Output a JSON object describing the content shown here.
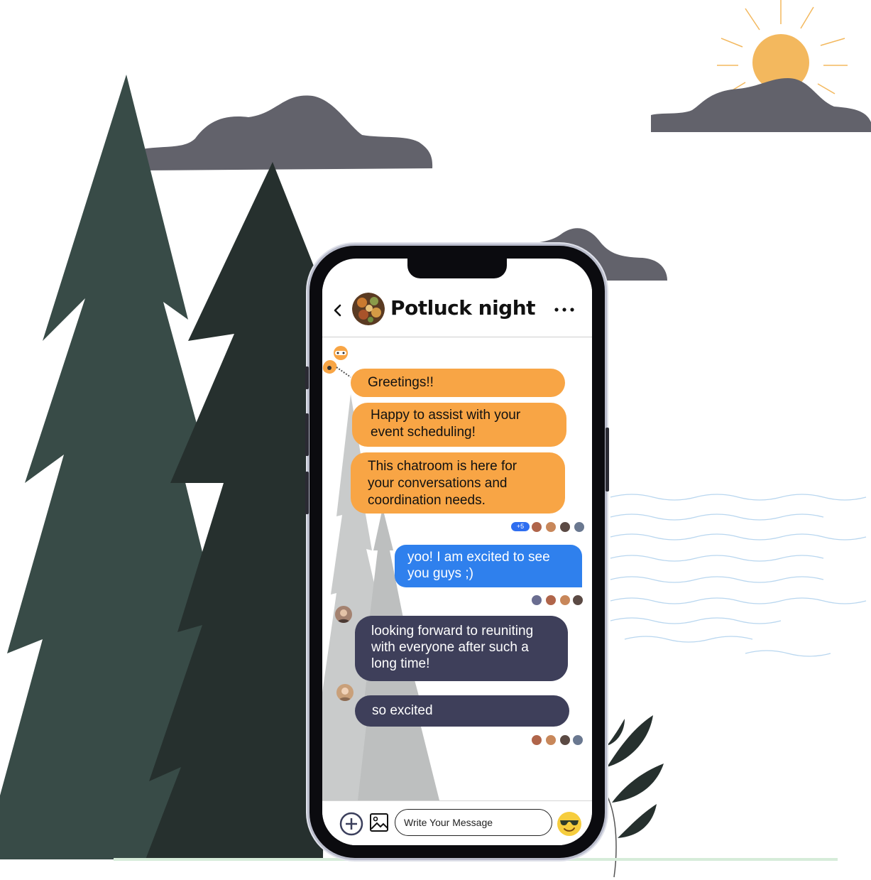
{
  "chat": {
    "title": "Potluck night",
    "back_icon": "chevron-left-icon",
    "more_icon": "more-horizontal-icon"
  },
  "messages": [
    {
      "sender": "bot",
      "text": "Greetings!!"
    },
    {
      "sender": "bot",
      "text": "Happy to assist with your event scheduling!"
    },
    {
      "sender": "bot",
      "text": "This chatroom is here for your conversations and coordination needs."
    },
    {
      "sender": "me",
      "text": "yoo! I am excited to see you guys ;)"
    },
    {
      "sender": "member",
      "text": "looking forward to reuniting with everyone after such a long time!"
    },
    {
      "sender": "member",
      "text": "so excited"
    }
  ],
  "read_receipts": {
    "extra_count": "+5"
  },
  "composer": {
    "placeholder": "Write Your Message",
    "add_icon": "plus-circle-icon",
    "image_icon": "image-icon",
    "emoji_icon": "sunglasses-emoji-icon"
  },
  "colors": {
    "bot_bubble": "#f8a545",
    "my_bubble": "#2f80ed",
    "member_bubble": "#3e3f5a",
    "tree_dark": "#26302e",
    "tree_green": "#384b47",
    "cloud": "#62626b",
    "sun": "#f3b85e"
  }
}
